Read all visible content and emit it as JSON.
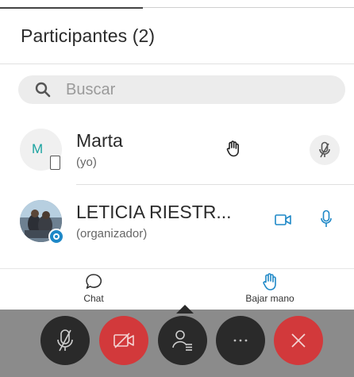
{
  "header": {
    "title": "Participantes (2)"
  },
  "search": {
    "icon": "search-icon",
    "placeholder": "Buscar"
  },
  "participants": [
    {
      "initial": "M",
      "name": "Marta",
      "role": "(yo)",
      "status_icons": [
        "device-phone-icon",
        "raised-hand-icon",
        "mic-muted-icon"
      ]
    },
    {
      "name": "LETICIA RIESTR...",
      "role": "(organizador)",
      "status_icons": [
        "video-camera-icon",
        "microphone-icon"
      ]
    }
  ],
  "tabs": {
    "chat_label": "Chat",
    "lower_hand_label": "Bajar mano"
  },
  "controls": [
    "mic-muted-icon",
    "video-off-icon",
    "participants-icon",
    "more-icon",
    "close-icon"
  ],
  "colors": {
    "accent": "#1e88c7",
    "teal": "#1ba3a0",
    "danger": "#d2393b",
    "control_bar": "#8b8b8b",
    "control_button": "#2a2a2a"
  }
}
